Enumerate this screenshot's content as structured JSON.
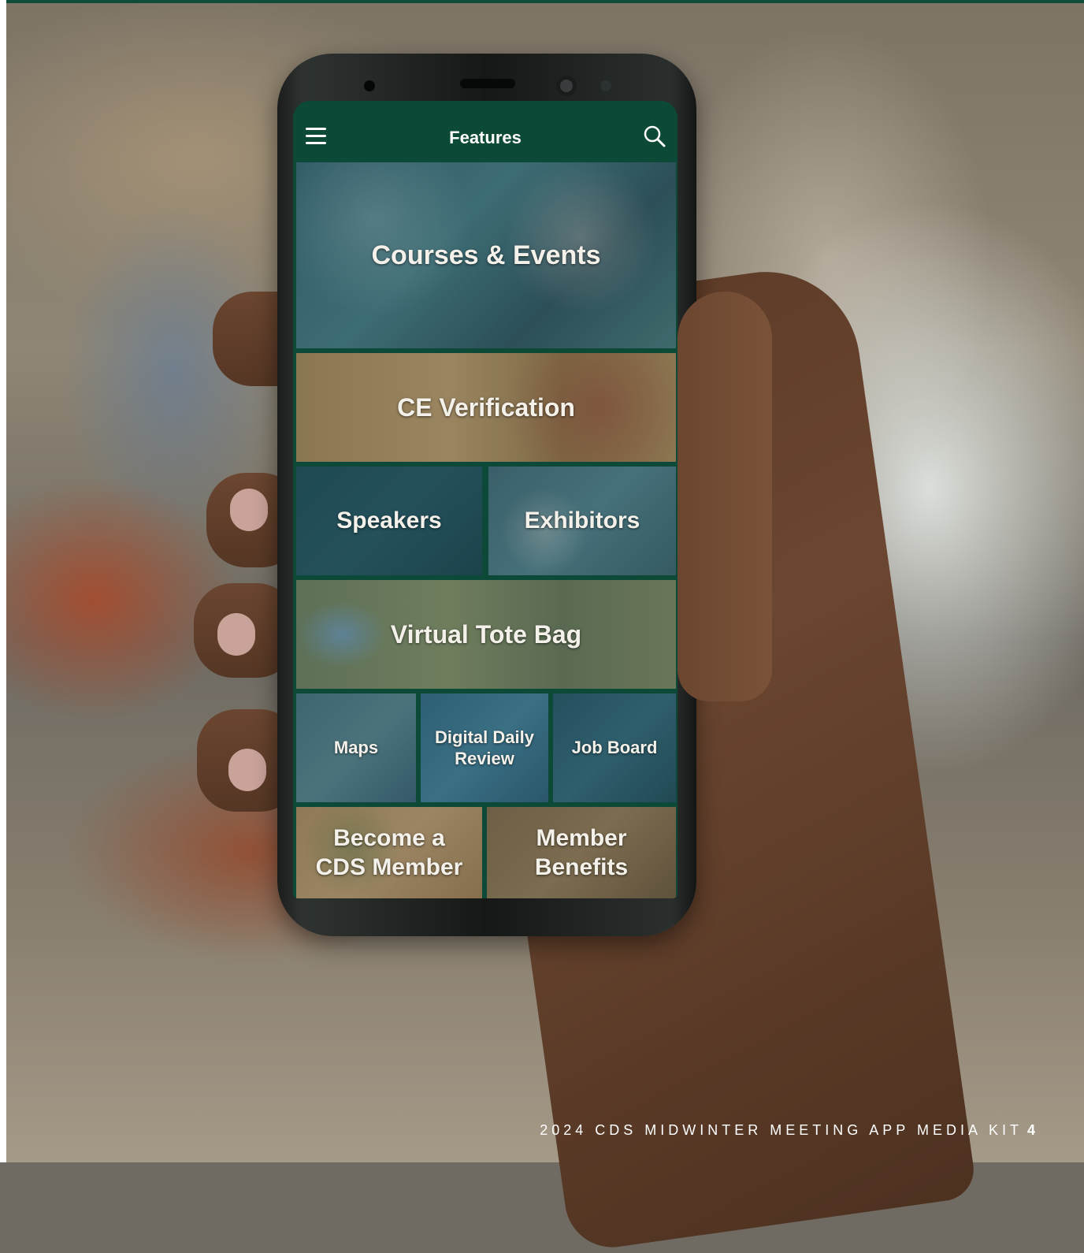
{
  "app": {
    "title": "Features"
  },
  "tiles": {
    "courses": "Courses & Events",
    "ce": "CE Verification",
    "speakers": "Speakers",
    "exhibitors": "Exhibitors",
    "tote": "Virtual Tote Bag",
    "maps": "Maps",
    "daily_line1": "Digital Daily",
    "daily_line2": "Review",
    "jobs": "Job Board",
    "become_line1": "Become a",
    "become_line2": "CDS Member",
    "benefits_line1": "Member",
    "benefits_line2": "Benefits"
  },
  "footer": {
    "text": "2024 CDS MIDWINTER MEETING APP MEDIA KIT",
    "page": "4"
  },
  "colors": {
    "brand_green": "#0c4a37",
    "text_white": "#ffffff"
  },
  "icons": [
    "menu-icon",
    "search-icon"
  ]
}
